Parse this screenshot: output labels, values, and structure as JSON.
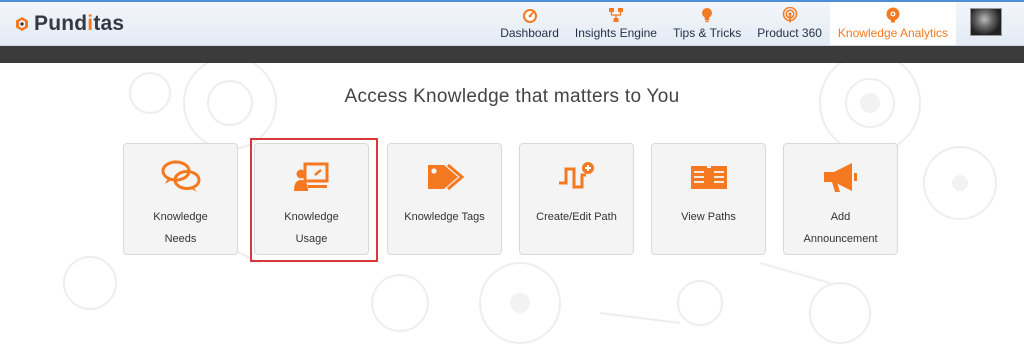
{
  "header": {
    "logo_prefix": "Pund",
    "logo_highlight": "i",
    "logo_suffix": "tas",
    "nav_items": [
      {
        "label": "Dashboard",
        "icon": "speedometer-icon"
      },
      {
        "label": "Insights Engine",
        "icon": "network-icon"
      },
      {
        "label": "Tips & Tricks",
        "icon": "lightbulb-icon"
      },
      {
        "label": "Product 360",
        "icon": "broadcast-icon"
      },
      {
        "label": "Knowledge Analytics",
        "icon": "brain-gear-icon",
        "active": true
      }
    ]
  },
  "main": {
    "title": "Access Knowledge that matters to You",
    "cards": [
      {
        "line1": "Knowledge",
        "line2": "Needs",
        "icon": "chat-bubbles-icon"
      },
      {
        "line1": "Knowledge",
        "line2": "Usage",
        "icon": "presenter-board-icon",
        "highlighted": true
      },
      {
        "line1": "Knowledge Tags",
        "line2": "",
        "icon": "tags-icon"
      },
      {
        "line1": "Create/Edit Path",
        "line2": "",
        "icon": "path-plus-icon"
      },
      {
        "line1": "View Paths",
        "line2": "",
        "icon": "open-book-icon"
      },
      {
        "line1": "Add",
        "line2": "Announcement",
        "icon": "megaphone-icon"
      }
    ]
  },
  "colors": {
    "accent": "#f47920",
    "highlight_border": "#d9363e",
    "dark_bar": "#3b3b3b"
  }
}
